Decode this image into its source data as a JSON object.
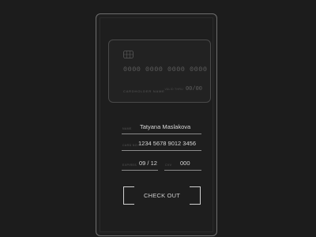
{
  "card": {
    "number": "0000 0000 0000 0000",
    "holder_label": "CARDHOLDER NAME",
    "expiry_label": "VALID THRU",
    "expiry": "00/00"
  },
  "form": {
    "name": {
      "label": "NAME",
      "value": "Tatyana Maslakova"
    },
    "card_number": {
      "label": "CARD NO.",
      "value": "1234 5678 9012 3456"
    },
    "expiry": {
      "label": "EXPIRES",
      "value": "09 / 12"
    },
    "cvv": {
      "label": "CVV",
      "value": "000"
    }
  },
  "checkout_label": "CHECK OUT",
  "icons": {
    "chip": "card-chip-icon"
  },
  "colors": {
    "background": "#1c1c1c",
    "device_border": "#6e6e6e",
    "text": "#d8d8d8"
  }
}
